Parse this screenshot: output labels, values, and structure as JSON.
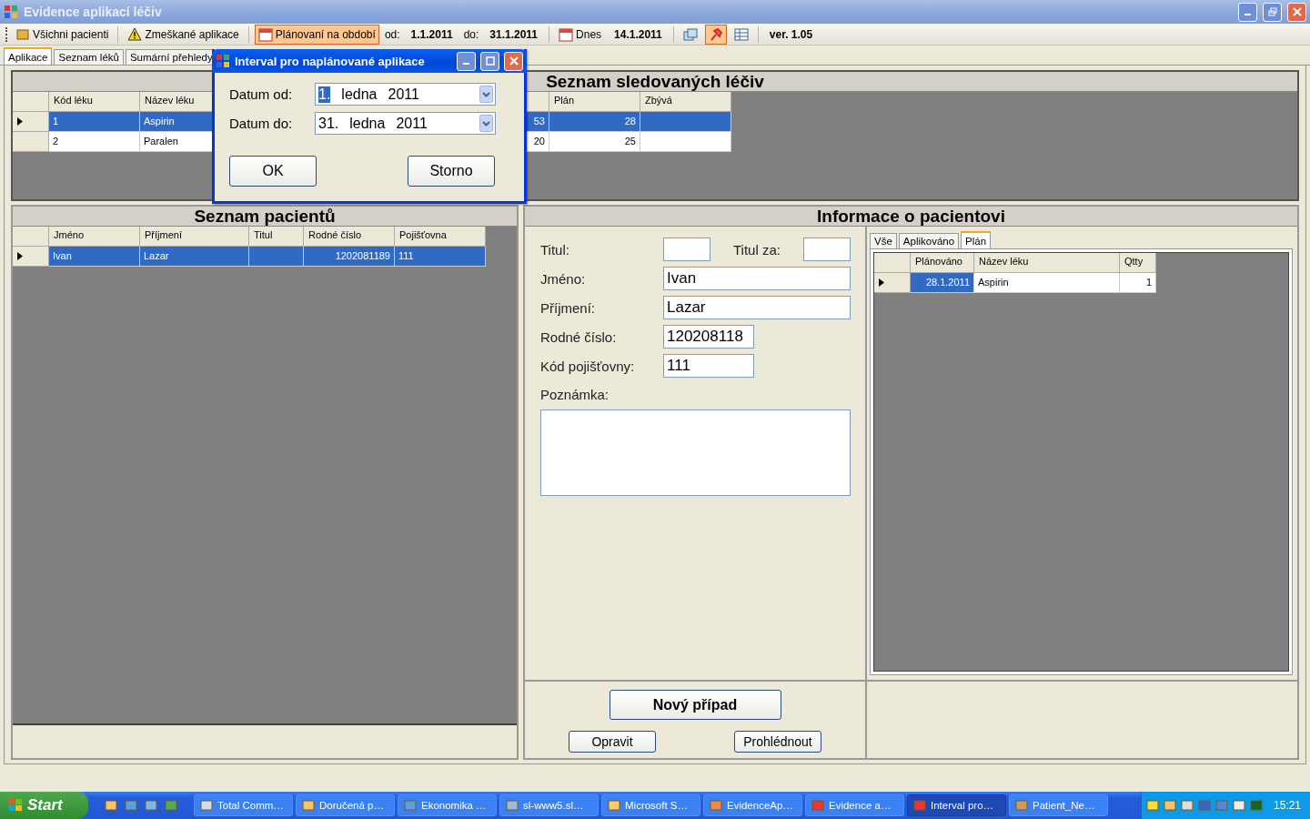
{
  "window": {
    "title": "Evidence aplikací léčiv"
  },
  "toolbar": [
    {
      "kind": "button",
      "label": "Všichni pacienti",
      "pressed": false
    },
    {
      "kind": "button",
      "label": "Zmeškané aplikace",
      "pressed": false
    },
    {
      "kind": "button",
      "label": "Plánovaní na období",
      "pressed": true
    },
    {
      "kind": "label",
      "label": "od:"
    },
    {
      "kind": "value",
      "label": "1.1.2011"
    },
    {
      "kind": "label",
      "label": "do:"
    },
    {
      "kind": "value",
      "label": "31.1.2011"
    },
    {
      "kind": "button",
      "label": "Dnes",
      "pressed": false
    },
    {
      "kind": "value",
      "label": "14.1.2011"
    },
    {
      "kind": "icon",
      "pressed": false
    },
    {
      "kind": "icon",
      "pressed": true
    },
    {
      "kind": "icon",
      "pressed": false
    },
    {
      "kind": "value",
      "label": "ver. 1.05"
    }
  ],
  "tabs": [
    {
      "label": "Aplikace",
      "selected": true
    },
    {
      "label": "Seznam léků",
      "selected": false
    },
    {
      "label": "Sumární přehledy",
      "selected": false
    }
  ],
  "medications": {
    "title": "Seznam sledovaných léčiv",
    "columns": [
      "Kód léku",
      "Název léku",
      "",
      "Plán",
      "Zbývá"
    ],
    "rows": [
      {
        "current": true,
        "selected": true,
        "cells": [
          "1",
          "Aspirin",
          "53",
          "28",
          ""
        ]
      },
      {
        "current": false,
        "selected": false,
        "cells": [
          "2",
          "Paralen",
          "20",
          "25",
          ""
        ]
      }
    ]
  },
  "patients": {
    "title": "Seznam pacientů",
    "columns": [
      "Jméno",
      "Příjmení",
      "Titul",
      "Rodné číslo",
      "Pojišťovna"
    ],
    "rows": [
      {
        "current": true,
        "selected": true,
        "cells": [
          "Ivan",
          "Lazar",
          "",
          "1202081189",
          "111"
        ]
      }
    ]
  },
  "patient_info": {
    "title": "Informace o pacientovi",
    "fields": [
      {
        "label": "Titul:"
      },
      {
        "label": "Titul za:"
      },
      {
        "label": "Jméno:",
        "value": "Ivan"
      },
      {
        "label": "Příjmení:",
        "value": "Lazar"
      },
      {
        "label": "Rodné číslo:",
        "value": "120208118"
      },
      {
        "label": "Kód pojišťovny:",
        "value": "111"
      },
      {
        "label": "Poznámka:"
      }
    ],
    "tabs": [
      {
        "label": "Vše",
        "selected": false
      },
      {
        "label": "Aplikováno",
        "selected": false
      },
      {
        "label": "Plán",
        "selected": true
      }
    ],
    "plan": {
      "columns": [
        "Plánováno",
        "Název léku",
        "Qtty"
      ],
      "rows": [
        {
          "current": true,
          "selected_cells": [
            true,
            false,
            false
          ],
          "cells": [
            "28.1.2011",
            "Aspirin",
            "1"
          ]
        }
      ]
    },
    "buttons": [
      "Nový případ",
      "Opravit",
      "Prohlédnout"
    ]
  },
  "dialog": {
    "title": "Interval pro naplánované aplikace",
    "fields": [
      {
        "label": "Datum od:",
        "day": "1.",
        "month": "ledna",
        "year": "2011",
        "day_selected": true
      },
      {
        "label": "Datum do:",
        "day": "31.",
        "month": "ledna",
        "year": "2011",
        "day_selected": false
      }
    ],
    "buttons": [
      "OK",
      "Storno"
    ]
  },
  "taskbar": {
    "start": "Start",
    "tasks": [
      {
        "label": "Total Comm…",
        "selected": false
      },
      {
        "label": "Doručená p…",
        "selected": false
      },
      {
        "label": "Ekonomika …",
        "selected": false
      },
      {
        "label": "sl-www5.sl…",
        "selected": false
      },
      {
        "label": "Microsoft S…",
        "selected": false
      },
      {
        "label": "EvidenceAp…",
        "selected": false
      },
      {
        "label": "Evidence a…",
        "selected": false
      },
      {
        "label": "Interval pro…",
        "selected": true
      },
      {
        "label": "Patient_Ne…",
        "selected": false
      }
    ],
    "clock": "15:21"
  }
}
